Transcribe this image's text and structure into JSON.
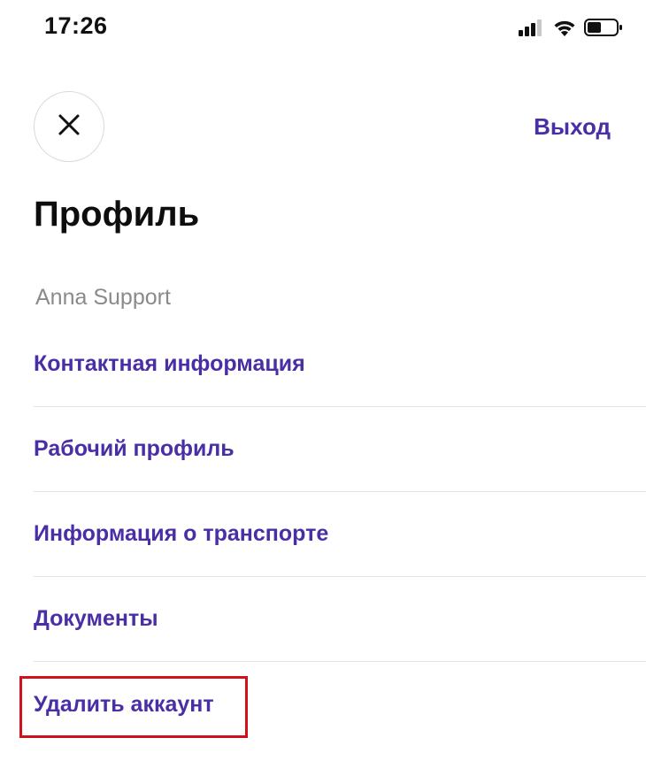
{
  "status_bar": {
    "time": "17:26",
    "icons": [
      "cellular-signal-icon",
      "wifi-icon",
      "battery-icon"
    ]
  },
  "header": {
    "close_icon": "close-icon",
    "logout_label": "Выход"
  },
  "profile": {
    "title": "Профиль",
    "user_name": "Anna Support"
  },
  "menu": {
    "items": [
      {
        "label": "Контактная информация"
      },
      {
        "label": "Рабочий профиль"
      },
      {
        "label": "Информация о транспорте"
      },
      {
        "label": "Документы"
      },
      {
        "label": "Удалить аккаунт",
        "highlighted": true
      }
    ]
  },
  "colors": {
    "accent": "#4a2ea6",
    "highlight_border": "#d0101a",
    "muted_text": "#8a8a8a",
    "divider": "#e2e2e2"
  }
}
